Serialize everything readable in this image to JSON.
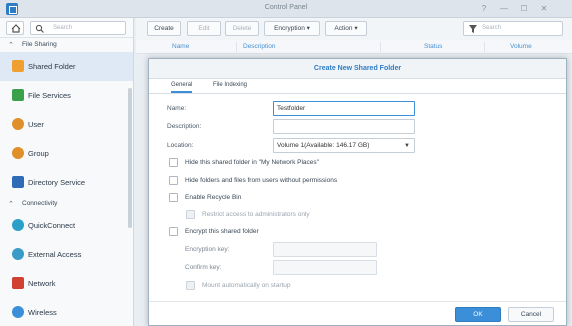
{
  "window": {
    "title": "Control Panel"
  },
  "sidebar": {
    "search_placeholder": "Search",
    "sections": [
      {
        "label": "File Sharing",
        "items": [
          {
            "label": "Shared Folder",
            "icon": "shared-folder-icon",
            "color": "#f0a030",
            "active": true
          },
          {
            "label": "File Services",
            "icon": "file-services-icon",
            "color": "#3aa04a"
          },
          {
            "label": "User",
            "icon": "user-icon",
            "color": "#e0902a"
          },
          {
            "label": "Group",
            "icon": "group-icon",
            "color": "#e0902a"
          },
          {
            "label": "Directory Service",
            "icon": "directory-service-icon",
            "color": "#2e6cb8"
          }
        ]
      },
      {
        "label": "Connectivity",
        "items": [
          {
            "label": "QuickConnect",
            "icon": "quickconnect-icon",
            "color": "#2aa0c8"
          },
          {
            "label": "External Access",
            "icon": "external-access-icon",
            "color": "#3a9ac8"
          },
          {
            "label": "Network",
            "icon": "network-icon",
            "color": "#d04030"
          },
          {
            "label": "Wireless",
            "icon": "wireless-icon",
            "color": "#3a8fd8"
          }
        ]
      }
    ]
  },
  "toolbar": {
    "create": "Create",
    "edit": "Edit",
    "delete": "Delete",
    "encryption": "Encryption",
    "action": "Action",
    "search_placeholder": "Search"
  },
  "grid": {
    "columns": [
      "Name",
      "Description",
      "Status",
      "Volume"
    ]
  },
  "dialog": {
    "title": "Create New Shared Folder",
    "tabs": [
      "General",
      "File Indexing"
    ],
    "name_label": "Name:",
    "name_value": "Testfolder",
    "description_label": "Description:",
    "description_value": "",
    "location_label": "Location:",
    "location_value": "Volume 1(Available: 146.17 GB)",
    "options": [
      "Hide this shared folder in \"My Network Places\"",
      "Hide folders and files from users without permissions",
      "Enable Recycle Bin",
      "Restrict access to administrators only",
      "Encrypt this shared folder"
    ],
    "encryption_key_label": "Encryption key:",
    "confirm_key_label": "Confirm key:",
    "mount_auto": "Mount automatically on startup",
    "ok": "OK",
    "cancel": "Cancel"
  },
  "colors": {
    "accent": "#3a8fd8",
    "title_blue": "#2e7cc4"
  }
}
